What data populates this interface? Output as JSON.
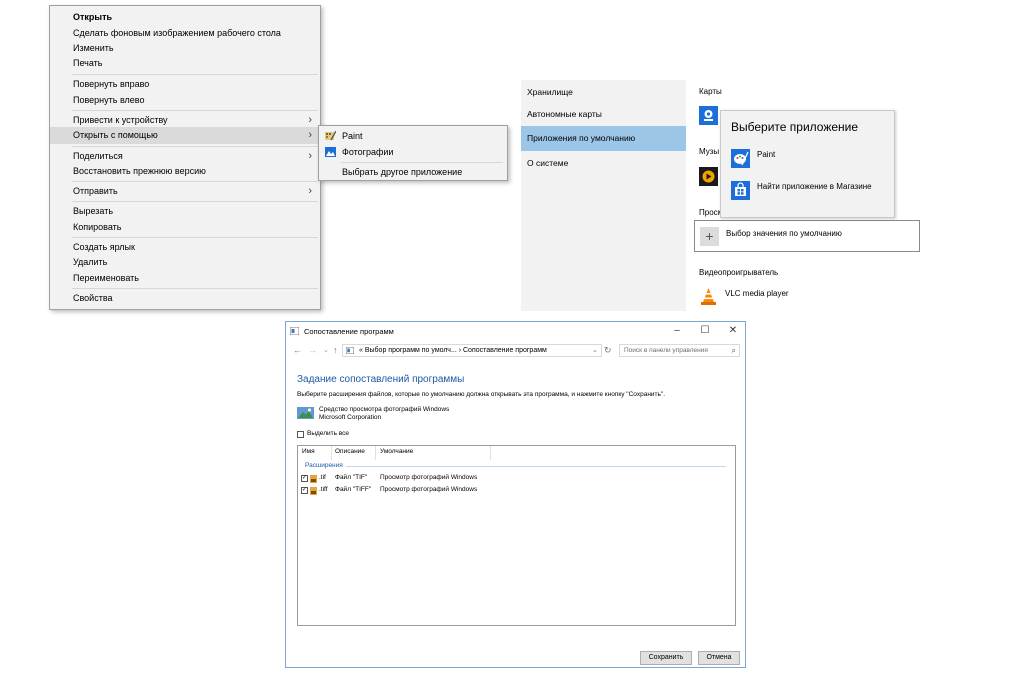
{
  "context_menu": {
    "items": [
      {
        "label": "Открыть"
      },
      {
        "label": "Сделать фоновым изображением рабочего стола"
      },
      {
        "label": "Изменить"
      },
      {
        "label": "Печать"
      },
      {
        "label": "Повернуть вправо"
      },
      {
        "label": "Повернуть влево"
      },
      {
        "label": "Привести к устройству"
      },
      {
        "label": "Открыть с помощью"
      },
      {
        "label": "Поделиться"
      },
      {
        "label": "Восстановить прежнюю версию"
      },
      {
        "label": "Отправить"
      },
      {
        "label": "Вырезать"
      },
      {
        "label": "Копировать"
      },
      {
        "label": "Создать ярлык"
      },
      {
        "label": "Удалить"
      },
      {
        "label": "Переименовать"
      },
      {
        "label": "Свойства"
      }
    ]
  },
  "open_with_submenu": {
    "items": [
      {
        "label": "Paint"
      },
      {
        "label": "Фотографии"
      },
      {
        "label": "Выбрать другое приложение"
      }
    ]
  },
  "settings": {
    "nav": [
      {
        "label": "Хранилище"
      },
      {
        "label": "Автономные карты"
      },
      {
        "label": "Приложения по умолчанию"
      },
      {
        "label": "О системе"
      }
    ],
    "sections": {
      "maps": "Карты",
      "music_partial": "Музы",
      "viewer_partial": "Просм",
      "video": "Видеопроигрыватель"
    },
    "default_choice": "Выбор значения по умолчанию",
    "video_app": "VLC media player",
    "popup": {
      "title": "Выберите приложение",
      "items": [
        {
          "label": "Paint"
        },
        {
          "label": "Найти приложение в Магазине"
        }
      ]
    }
  },
  "control_panel": {
    "window_title": "Сопоставление программ",
    "address": "« Выбор программ по умолч... › Сопоставление программ",
    "search_placeholder": "Поиск в панели управления",
    "heading": "Задание сопоставлений программы",
    "description": "Выберите расширения файлов, которые по умолчанию должна открывать эта программа, и нажмите кнопку \"Сохранить\".",
    "program_name": "Средство просмотра фотографий Windows",
    "program_vendor": "Microsoft Corporation",
    "select_all": "Выделить все",
    "columns": [
      "Имя",
      "Описание",
      "Умолчание"
    ],
    "group": "Расширения",
    "rows": [
      {
        "name": ".tif",
        "description": "Файл \"TIF\"",
        "default": "Просмотр фотографий Windows"
      },
      {
        "name": ".tiff",
        "description": "Файл \"TIFF\"",
        "default": "Просмотр фотографий Windows"
      }
    ],
    "save_label": "Сохранить",
    "cancel_label": "Отмена"
  },
  "colors": {
    "selected_nav": "#9cc6e8",
    "heading_blue": "#1e5aa8",
    "window_border": "#7aa5d6"
  }
}
